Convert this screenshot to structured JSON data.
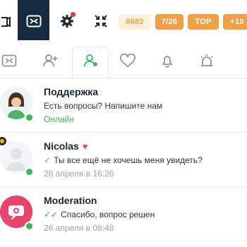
{
  "topbar": {
    "stats": [
      "8882",
      "7/26",
      "TOP",
      "+10"
    ],
    "colors": {
      "dark": "#172a3f",
      "accent": "#f0a047",
      "accent_light": "#fff1de",
      "red_dot": "#e8383d"
    }
  },
  "tabs": [
    {
      "icon": "messages-icon"
    },
    {
      "icon": "add-user-icon"
    },
    {
      "icon": "user-icon",
      "active": true
    },
    {
      "icon": "heart-icon"
    },
    {
      "icon": "bell-icon"
    },
    {
      "icon": "alert-light-icon"
    }
  ],
  "chats": [
    {
      "name": "Поддержка",
      "message": "Есть вопросы? Напишите нам",
      "status": "Онлайн"
    },
    {
      "name": "Nicolas",
      "message": "Ты все ещё не хочешь меня увидеть?",
      "status": "26 апреля в 16:26"
    },
    {
      "name": "Moderation",
      "message": "Спасибо, вопрос решен",
      "status": "26 апреля в 08:48"
    }
  ]
}
